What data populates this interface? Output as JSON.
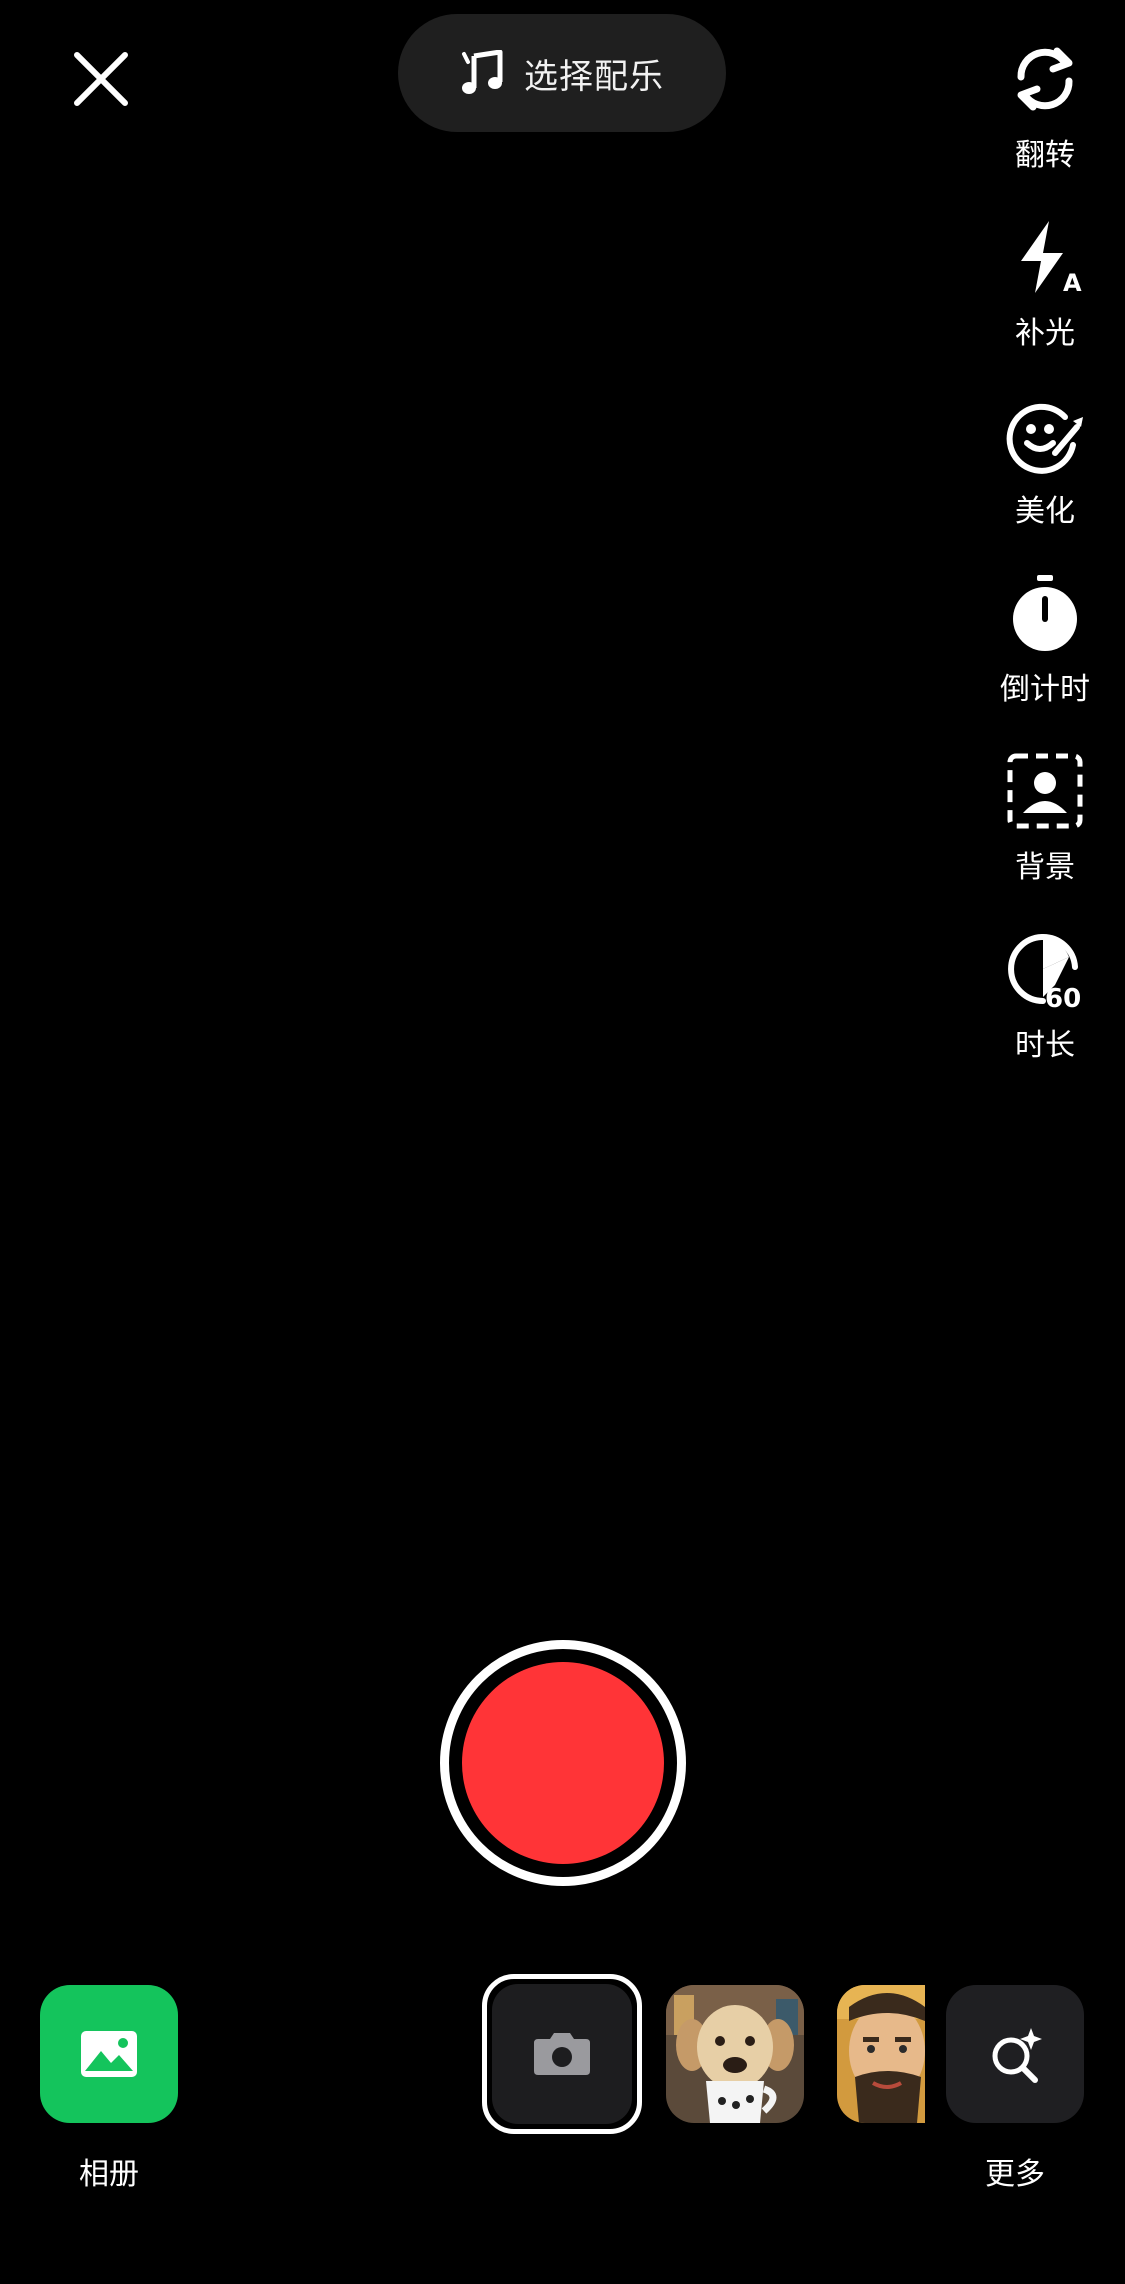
{
  "top": {
    "close_icon": "close-icon",
    "music_icon": "music-note-icon",
    "music_label": "选择配乐"
  },
  "tools": [
    {
      "icon": "flip-camera-icon",
      "label": "翻转"
    },
    {
      "icon": "flash-auto-icon",
      "label": "补光"
    },
    {
      "icon": "beautify-icon",
      "label": "美化"
    },
    {
      "icon": "timer-icon",
      "label": "倒计时"
    },
    {
      "icon": "background-icon",
      "label": "背景"
    },
    {
      "icon": "duration-60-icon",
      "label": "时长",
      "badge": "60"
    }
  ],
  "record": {
    "color": "#ff3437"
  },
  "bottom": {
    "album_label": "相册",
    "album_color": "#14c45c",
    "more_label": "更多"
  }
}
